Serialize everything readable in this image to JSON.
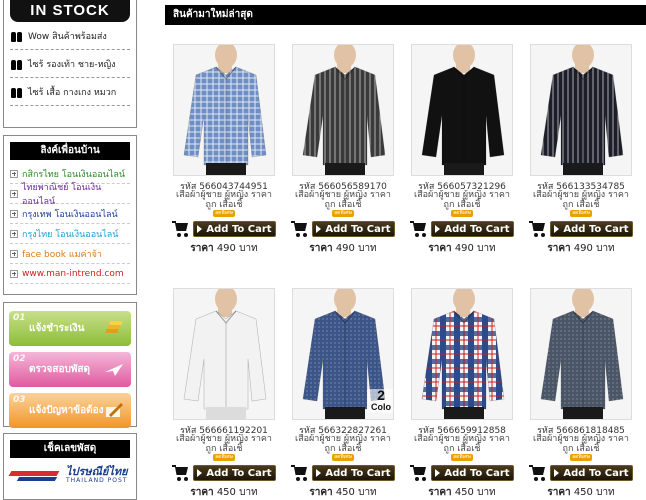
{
  "sidebar": {
    "instock": {
      "banner": "IN STOCK",
      "items": [
        {
          "label": "Wow สินค้าพร้อมส่ง"
        },
        {
          "label": "ไซร้ รองเท้า ชาย-หญิง"
        },
        {
          "label": "ไซร้ เสื้อ กางเกง หมวก"
        }
      ]
    },
    "links": {
      "title": "ลิงค์เพื่อนบ้าน",
      "items": [
        {
          "label": "กสิกรไทย โอนเงินออนไลน์",
          "color": "#2a8a2a"
        },
        {
          "label": "ไทยพาณิชย์ โอนเงินออนไลน์",
          "color": "#6a2a9a"
        },
        {
          "label": "กรุงเทพ โอนเงินออนไลน์",
          "color": "#1a3e9c"
        },
        {
          "label": "กรุงไทย โอนเงินออนไลน์",
          "color": "#1aa0d0"
        },
        {
          "label": "face book แมค่าจ้า",
          "color": "#e07a10"
        },
        {
          "label": "www.man-intrend.com",
          "color": "#d02020"
        }
      ]
    },
    "payments": [
      {
        "num": "01",
        "label": "แจ้งชำระเงิน"
      },
      {
        "num": "02",
        "label": "ตรวจสอบพัสดุ"
      },
      {
        "num": "03",
        "label": "แจ้งปัญหาข้อต้อง"
      }
    ],
    "tracking": {
      "title": "เช็คเลขพัสดุ",
      "logo_text": "ไปรษณีย์ไทย",
      "logo_sub": "THAILAND POST"
    }
  },
  "main": {
    "section_title": "สินค้ามาใหม่ล่าสุด",
    "add_to_cart": "Add To Cart",
    "price_label": "ราคา",
    "currency": "บาท",
    "badge": "ลดพิเศษ",
    "products": [
      {
        "code": "รหัส 566043744951",
        "desc": "เสื้อผ้าผู้ชาย ผู้หญิง ราคาถูก เสื้อเชิ้",
        "price": "490",
        "shirt": "#6f8fc4",
        "pattern": "check"
      },
      {
        "code": "รหัส 566056589170",
        "desc": "เสื้อผ้าผู้ชาย ผู้หญิง ราคาถูก เสื้อเชิ้",
        "price": "490",
        "shirt": "#3a3a3a",
        "pattern": "stripe"
      },
      {
        "code": "รหัส 566057321296",
        "desc": "เสื้อผ้าผู้ชาย ผู้หญิง ราคาถูก เสื้อเชิ้",
        "price": "490",
        "shirt": "#111111",
        "pattern": "plain"
      },
      {
        "code": "รหัส 566133534785",
        "desc": "เสื้อผ้าผู้ชาย ผู้หญิง ราคาถูก เสื้อเชิ้",
        "price": "490",
        "shirt": "#1e1e2a",
        "pattern": "stripe"
      },
      {
        "code": "รหัส 566661192201",
        "desc": "เสื้อผ้าผู้ชาย ผู้หญิง ราคาถูก เสื้อเชิ้",
        "price": "450",
        "shirt": "#f2f2f2",
        "pattern": "plain"
      },
      {
        "code": "รหัส 566322827261",
        "desc": "เสื้อผ้าผู้ชาย ผู้หญิง ราคาถูก เสื้อเชิ้",
        "price": "450",
        "shirt": "#3c5588",
        "pattern": "dots"
      },
      {
        "code": "รหัส 566659912858",
        "desc": "เสื้อผ้าผู้ชาย ผู้หญิง ราคาถูก เสื้อเชิ้",
        "price": "450",
        "shirt": "#2d4a8a",
        "pattern": "plaid"
      },
      {
        "code": "รหัส 566861818485",
        "desc": "เสื้อผ้าผู้ชาย ผู้หญิง ราคาถูก เสื้อเชิ้",
        "price": "450",
        "shirt": "#4a5566",
        "pattern": "dots"
      }
    ],
    "thumb_overlay_text": {
      "number": "2",
      "word": "Colo"
    }
  }
}
